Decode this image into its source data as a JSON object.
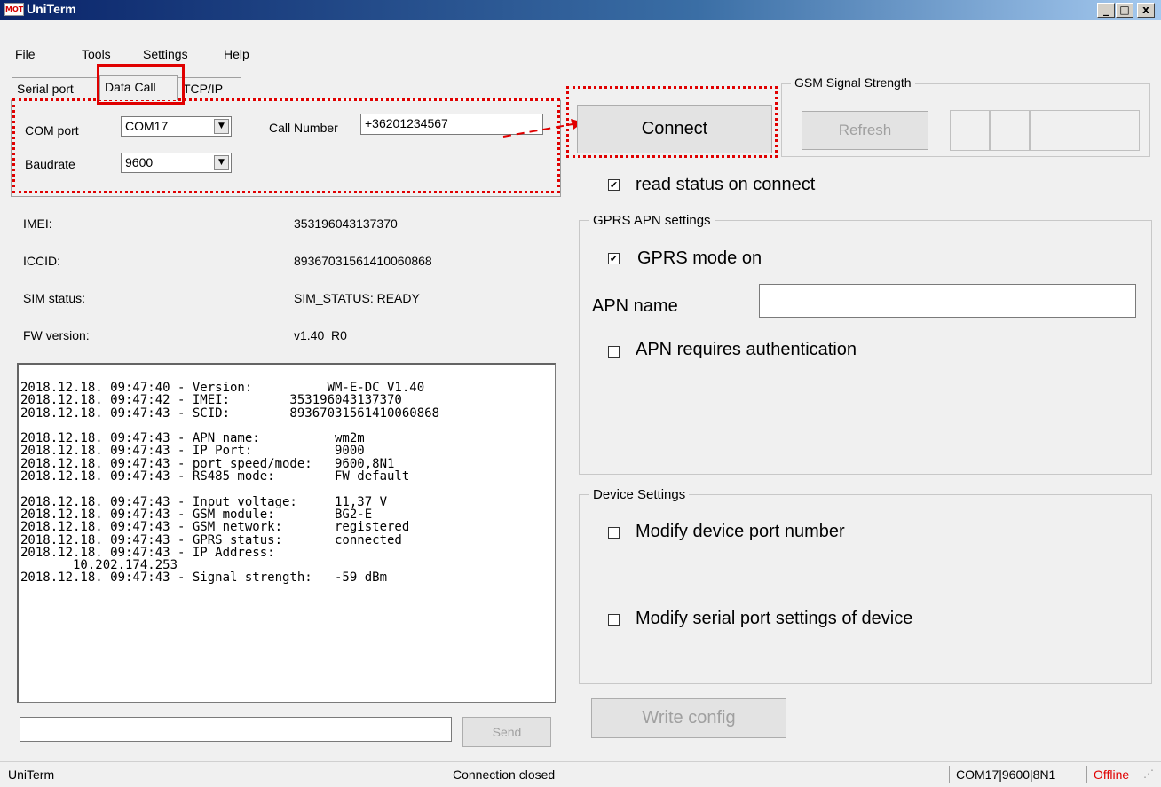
{
  "window": {
    "title": "UniTerm",
    "icon": "app-logo-icon",
    "min": "_",
    "max": "□",
    "close": "x"
  },
  "menu": [
    "File",
    "Tools",
    "Settings",
    "Help"
  ],
  "tabs": [
    "Serial port",
    "Data Call",
    "TCP/IP"
  ],
  "data_call": {
    "com_port_label": "COM port",
    "com_port_value": "COM17",
    "baudrate_label": "Baudrate",
    "baudrate_value": "9600",
    "call_number_label": "Call Number",
    "call_number_value": "+36201234567"
  },
  "connect_label": "Connect",
  "gsm": {
    "title": "GSM Signal Strength",
    "refresh_label": "Refresh"
  },
  "read_status": {
    "label": "read status on connect",
    "checked": "✔"
  },
  "info": [
    {
      "label": "IMEI:",
      "value": "353196043137370"
    },
    {
      "label": "ICCID:",
      "value": "89367031561410060868"
    },
    {
      "label": "SIM status:",
      "value": "SIM_STATUS: READY"
    },
    {
      "label": "FW version:",
      "value": "v1.40_R0"
    }
  ],
  "log_text": "2018.12.18. 09:47:40 - Version:          WM-E-DC V1.40\n2018.12.18. 09:47:42 - IMEI:        353196043137370\n2018.12.18. 09:47:43 - SCID:        89367031561410060868\n\n2018.12.18. 09:47:43 - APN name:          wm2m\n2018.12.18. 09:47:43 - IP Port:           9000\n2018.12.18. 09:47:43 - port speed/mode:   9600,8N1\n2018.12.18. 09:47:43 - RS485 mode:        FW default\n\n2018.12.18. 09:47:43 - Input voltage:     11,37 V\n2018.12.18. 09:47:43 - GSM module:        BG2-E\n2018.12.18. 09:47:43 - GSM network:       registered\n2018.12.18. 09:47:43 - GPRS status:       connected\n2018.12.18. 09:47:43 - IP Address:\n       10.202.174.253\n2018.12.18. 09:47:43 - Signal strength:   -59 dBm",
  "send_label": "Send",
  "gprs": {
    "title": "GPRS APN settings",
    "mode_label": "GPRS mode on",
    "mode_checked": "✔",
    "apn_name_label": "APN name",
    "apn_name_value": "",
    "auth_label": "APN requires authentication"
  },
  "device": {
    "title": "Device Settings",
    "modify_port_label": "Modify device port number",
    "modify_serial_label": "Modify serial port settings of device"
  },
  "write_config_label": "Write config",
  "statusbar": {
    "app": "UniTerm",
    "connection": "Connection closed",
    "port_info": "COM17|9600|8N1",
    "state": "Offline",
    "state_color": "#e00000"
  }
}
